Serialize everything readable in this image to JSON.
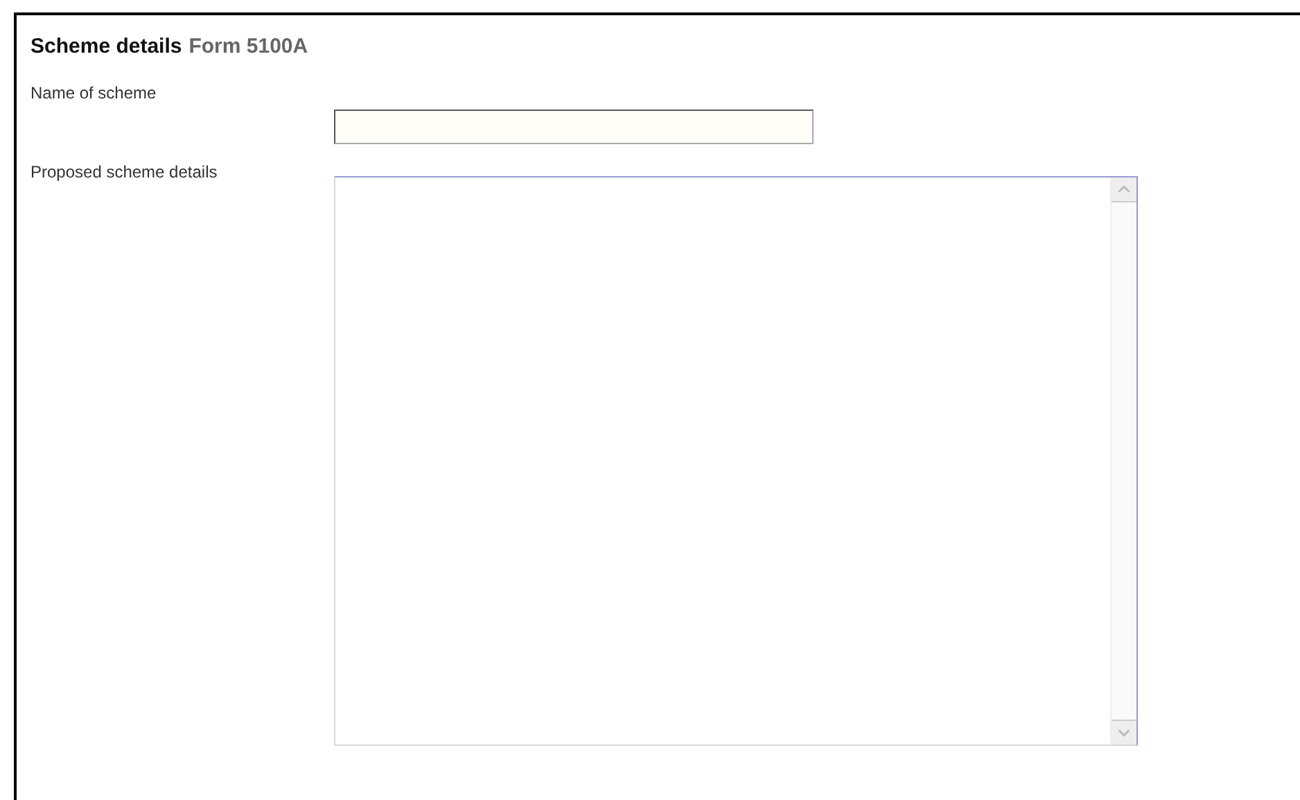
{
  "heading": {
    "title": "Scheme details",
    "subtitle": "Form 5100A"
  },
  "fields": [
    {
      "kind": "text",
      "label": "Name of scheme"
    },
    {
      "kind": "textarea",
      "label": "Proposed scheme details"
    }
  ]
}
